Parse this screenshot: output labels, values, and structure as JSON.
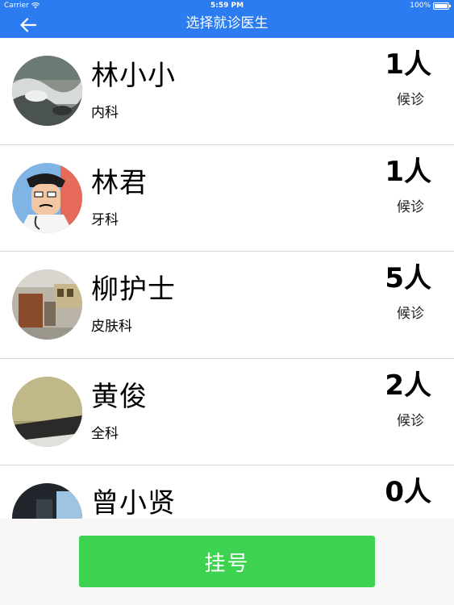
{
  "status_bar": {
    "carrier": "Carrier",
    "time": "5:59 PM",
    "battery": "100%"
  },
  "nav": {
    "title": "选择就诊医生",
    "back_icon": "arrow-left-icon"
  },
  "doctors": [
    {
      "name": "林小小",
      "department": "内科",
      "count": "1人",
      "wait_label": "候诊"
    },
    {
      "name": "林君",
      "department": "牙科",
      "count": "1人",
      "wait_label": "候诊"
    },
    {
      "name": "柳护士",
      "department": "皮肤科",
      "count": "5人",
      "wait_label": "候诊"
    },
    {
      "name": "黄俊",
      "department": "全科",
      "count": "2人",
      "wait_label": "候诊"
    },
    {
      "name": "曾小贤",
      "department": "",
      "count": "0人",
      "wait_label": ""
    }
  ],
  "footer": {
    "register_label": "挂号"
  },
  "colors": {
    "nav": "#2b7cf0",
    "button": "#3dd24f",
    "divider": "#d9d9d9"
  }
}
